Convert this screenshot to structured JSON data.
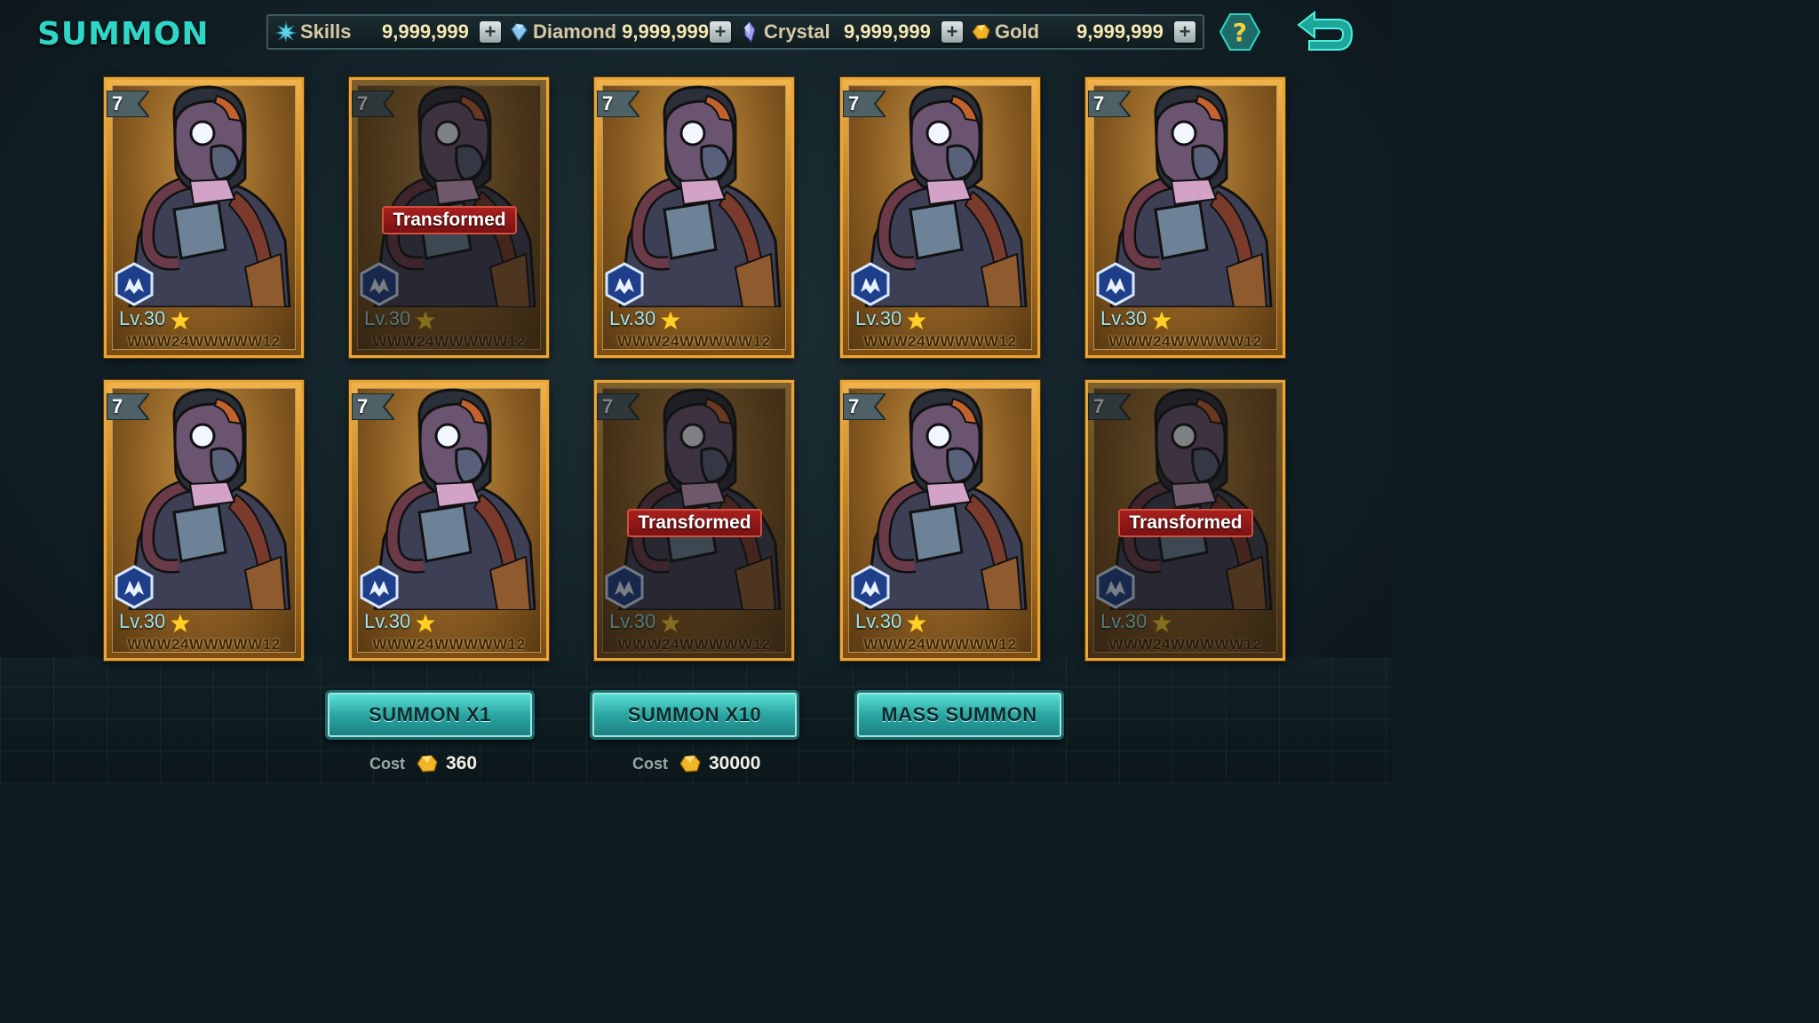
{
  "header": {
    "title": "SUMMON"
  },
  "resources": [
    {
      "icon": "skills-icon",
      "label": "Skills",
      "value": "9,999,999"
    },
    {
      "icon": "diamond-icon",
      "label": "Diamond",
      "value": "9,999,999"
    },
    {
      "icon": "crystal-icon",
      "label": "Crystal",
      "value": "9,999,999"
    },
    {
      "icon": "gold-icon",
      "label": "Gold",
      "value": "9,999,999"
    }
  ],
  "plus_label": "+",
  "help_label": "?",
  "cards": [
    {
      "rank": "7",
      "level": "Lv.30",
      "name": "WWW24WWWWW12",
      "transformed": false,
      "transformed_label": ""
    },
    {
      "rank": "7",
      "level": "Lv.30",
      "name": "WWW24WWWWW12",
      "transformed": true,
      "transformed_label": "Transformed"
    },
    {
      "rank": "7",
      "level": "Lv.30",
      "name": "WWW24WWWWW12",
      "transformed": false,
      "transformed_label": ""
    },
    {
      "rank": "7",
      "level": "Lv.30",
      "name": "WWW24WWWWW12",
      "transformed": false,
      "transformed_label": ""
    },
    {
      "rank": "7",
      "level": "Lv.30",
      "name": "WWW24WWWWW12",
      "transformed": false,
      "transformed_label": ""
    },
    {
      "rank": "7",
      "level": "Lv.30",
      "name": "WWW24WWWWW12",
      "transformed": false,
      "transformed_label": ""
    },
    {
      "rank": "7",
      "level": "Lv.30",
      "name": "WWW24WWWWW12",
      "transformed": false,
      "transformed_label": ""
    },
    {
      "rank": "7",
      "level": "Lv.30",
      "name": "WWW24WWWWW12",
      "transformed": true,
      "transformed_label": "Transformed"
    },
    {
      "rank": "7",
      "level": "Lv.30",
      "name": "WWW24WWWWW12",
      "transformed": false,
      "transformed_label": ""
    },
    {
      "rank": "7",
      "level": "Lv.30",
      "name": "WWW24WWWWW12",
      "transformed": true,
      "transformed_label": "Transformed"
    }
  ],
  "actions": {
    "summon_x1": {
      "label": "SUMMON X1",
      "cost_label": "Cost",
      "cost_value": "360"
    },
    "summon_x10": {
      "label": "SUMMON X10",
      "cost_label": "Cost",
      "cost_value": "30000"
    },
    "mass_summon": {
      "label": "MASS SUMMON"
    }
  },
  "colors": {
    "title": "#2fd6c5",
    "card_border": "#e8a63a",
    "button": "#2aa6a2",
    "transformed_badge": "#a8201e"
  }
}
